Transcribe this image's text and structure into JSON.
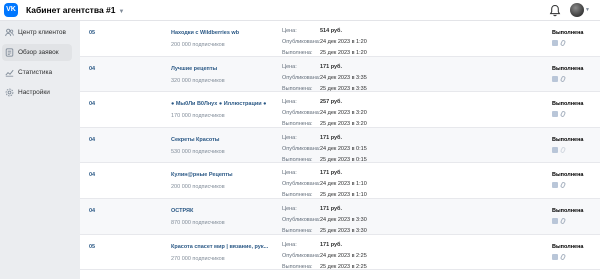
{
  "header": {
    "logo": "VK",
    "cabinet_title": "Кабинет агентства #1",
    "icons": [
      "bell-icon",
      "avatar",
      "chevron-down-icon"
    ]
  },
  "sidebar": {
    "items": [
      {
        "label": "Центр клиентов",
        "icon": "people-icon",
        "active": false
      },
      {
        "label": "Обзор заявок",
        "icon": "document-icon",
        "active": true
      },
      {
        "label": "Статистика",
        "icon": "chart-icon",
        "active": false
      },
      {
        "label": "Настройки",
        "icon": "gear-icon",
        "active": false
      }
    ]
  },
  "labels": {
    "price": "Цена:",
    "published": "Опубликована:",
    "completed": "Выполнена:"
  },
  "orders": [
    {
      "id": "05",
      "title": "Находки с Wildberries wb",
      "subscribers": "200 000 подписчиков",
      "price": "514 руб.",
      "published": "24 дек 2023 в 1:20",
      "completed": "25 дек 2023 в 1:20",
      "status": "Выполнена"
    },
    {
      "id": "04",
      "title": "Лучшие рецепты",
      "subscribers": "320 000 подписчиков",
      "price": "171 руб.",
      "published": "24 дек 2023 в 3:35",
      "completed": "25 дек 2023 в 3:35",
      "status": "Выполнена"
    },
    {
      "id": "04",
      "title": "● Мы0Ли В0Лнух ● Иллюстрации ●",
      "subscribers": "170 000 подписчиков",
      "price": "257 руб.",
      "published": "24 дек 2023 в 3:20",
      "completed": "25 дек 2023 в 3:20",
      "status": "Выполнена"
    },
    {
      "id": "04",
      "title": "Секреты Красоты",
      "subscribers": "530 000 подписчиков",
      "price": "171 руб.",
      "published": "24 дек 2023 в 0:15",
      "completed": "25 дек 2023 в 0:15",
      "status": "Выполнена"
    },
    {
      "id": "04",
      "title": "Кулин@рные Рецепты",
      "subscribers": "200 000 подписчиков",
      "price": "171 руб.",
      "published": "24 дек 2023 в 1:10",
      "completed": "25 дек 2023 в 1:10",
      "status": "Выполнена"
    },
    {
      "id": "04",
      "title": "ОСТРЯК",
      "subscribers": "870 000 подписчиков",
      "price": "171 руб.",
      "published": "24 дек 2023 в 3:30",
      "completed": "25 дек 2023 в 3:30",
      "status": "Выполнена"
    },
    {
      "id": "05",
      "title": "Красота спасет мир | вязание, рук...",
      "subscribers": "270 000 подписчиков",
      "price": "171 руб.",
      "published": "24 дек 2023 в 2:25",
      "completed": "25 дек 2023 в 2:25",
      "status": "Выполнена"
    }
  ]
}
